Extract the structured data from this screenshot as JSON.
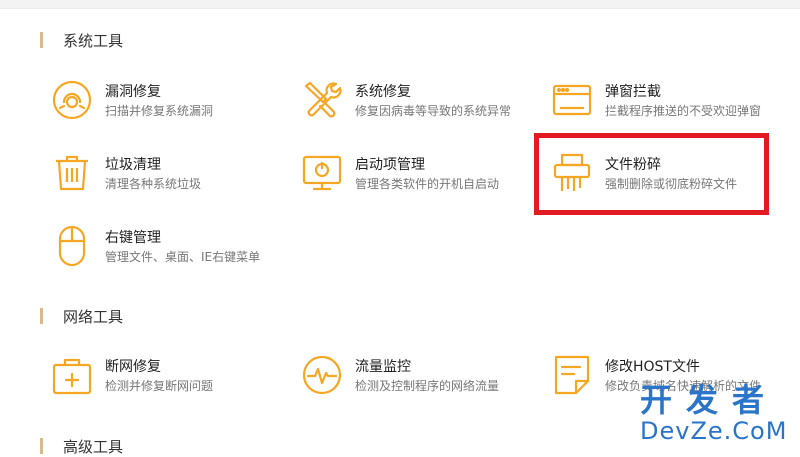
{
  "sections": [
    {
      "title": "系统工具"
    },
    {
      "title": "网络工具"
    },
    {
      "title": "高级工具"
    }
  ],
  "tools": [
    {
      "name": "漏洞修复",
      "desc": "扫描并修复系统漏洞",
      "icon": "shield-ring-icon"
    },
    {
      "name": "系统修复",
      "desc": "修复因病毒等导致的系统异常",
      "icon": "wrench-screwdriver-icon"
    },
    {
      "name": "弹窗拦截",
      "desc": "拦截程序推送的不受欢迎弹窗",
      "icon": "popup-window-icon"
    },
    {
      "name": "垃圾清理",
      "desc": "清理各种系统垃圾",
      "icon": "trash-can-icon"
    },
    {
      "name": "启动项管理",
      "desc": "管理各类软件的开机自启动",
      "icon": "monitor-startup-icon"
    },
    {
      "name": "文件粉碎",
      "desc": "强制删除或彻底粉碎文件",
      "icon": "file-shredder-icon"
    },
    {
      "name": "右键管理",
      "desc": "管理文件、桌面、IE右键菜单",
      "icon": "mouse-icon"
    },
    {
      "name": "断网修复",
      "desc": "检测并修复断网问题",
      "icon": "network-kit-icon"
    },
    {
      "name": "流量监控",
      "desc": "检测及控制程序的网络流量",
      "icon": "traffic-pulse-icon"
    },
    {
      "name": "修改HOST文件",
      "desc": "修改负责域名快速解析的文件",
      "icon": "host-file-icon"
    }
  ],
  "watermark": {
    "cn": "开发者",
    "en": "DevZe.CoM"
  },
  "colors": {
    "accent": "#f5a623",
    "section_bar": "#d9b98f",
    "highlight": "#e21b23",
    "watermark": "#2a74c9"
  }
}
